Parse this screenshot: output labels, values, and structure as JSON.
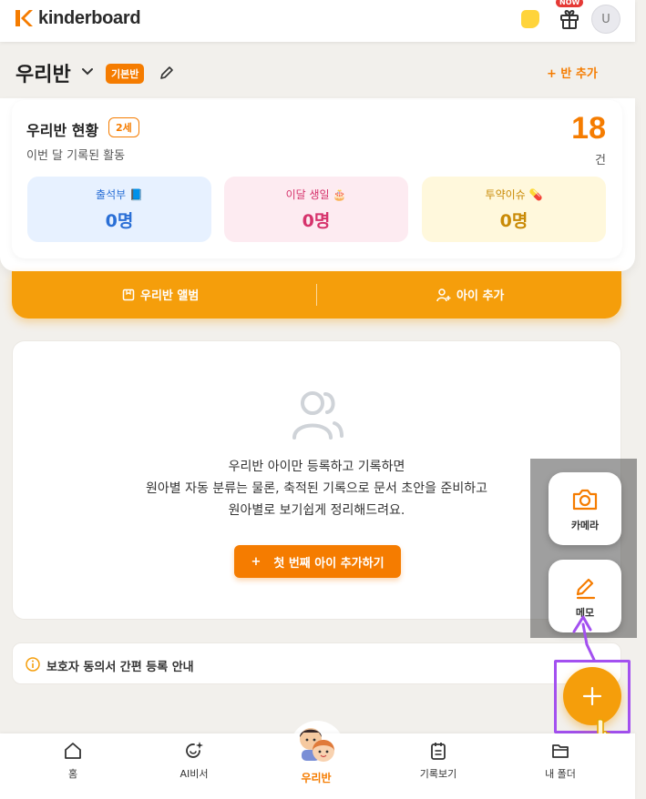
{
  "header": {
    "brand": "kinderboard",
    "new_badge": "NOW",
    "avatar_initial": "U"
  },
  "class_header": {
    "title": "우리반",
    "badge": "기본반",
    "add_class": "+ 반 추가"
  },
  "status": {
    "title": "우리반 현황",
    "age_badge": "2세",
    "subtitle": "이번 달 기록된 활동",
    "count": "18",
    "count_unit": "건",
    "stats": [
      {
        "label": "출석부 📘",
        "value": "0명"
      },
      {
        "label": "이달 생일 🎂",
        "value": "0명"
      },
      {
        "label": "투약이슈 💊",
        "value": "0명"
      }
    ]
  },
  "actions": {
    "album": "우리반 앨범",
    "add_child": "아이 추가"
  },
  "empty_state": {
    "line1": "우리반 아이만 등록하고 기록하면",
    "line2": "원아별 자동 분류는 물론, 축적된 기록으로 문서 초안을 준비하고",
    "line3": "원아별로 보기쉽게 정리해드려요.",
    "button": "첫 번째 아이 추가하기"
  },
  "guide": {
    "text": "보호자 동의서 간편 등록 안내"
  },
  "fab_menu": {
    "camera": "카메라",
    "memo": "메모"
  },
  "bottom_nav": {
    "items": [
      "홈",
      "AI비서",
      "우리반",
      "기록보기",
      "내 폴더"
    ]
  },
  "colors": {
    "accent": "#f57c00",
    "action_bar": "#f59e0b",
    "highlight": "#a350f0"
  }
}
